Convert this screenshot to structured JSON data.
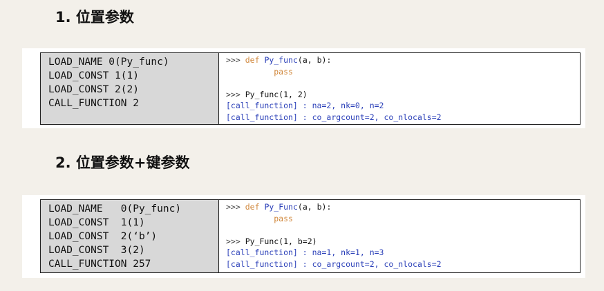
{
  "section1": {
    "heading": "1. 位置参数",
    "bytecode": [
      "LOAD_NAME 0(Py_func)",
      "LOAD_CONST 1(1)",
      "LOAD_CONST 2(2)",
      "CALL_FUNCTION 2"
    ],
    "python": {
      "prompt": ">>>",
      "def_keyword": "def",
      "def_rest_name": "Py_func",
      "def_rest_args": "(a, b):",
      "pass_keyword": "pass",
      "call": "Py_func(1, 2)",
      "output1": "[call_function] : na=2, nk=0, n=2",
      "output2": "[call_function] : co_argcount=2, co_nlocals=2"
    }
  },
  "section2": {
    "heading": "2. 位置参数+键参数",
    "bytecode": [
      "LOAD_NAME   0(Py_func)",
      "LOAD_CONST  1(1)",
      "LOAD_CONST  2(‘b’)",
      "LOAD_CONST  3(2)",
      "CALL_FUNCTION 257"
    ],
    "python": {
      "prompt": ">>>",
      "def_keyword": "def",
      "def_rest_name": "Py_Func",
      "def_rest_args": "(a, b):",
      "pass_keyword": "pass",
      "call": "Py_Func(1, b=2)",
      "output1": "[call_function] : na=1, nk=1, n=3",
      "output2": "[call_function] : co_argcount=2, co_nlocals=2"
    }
  }
}
